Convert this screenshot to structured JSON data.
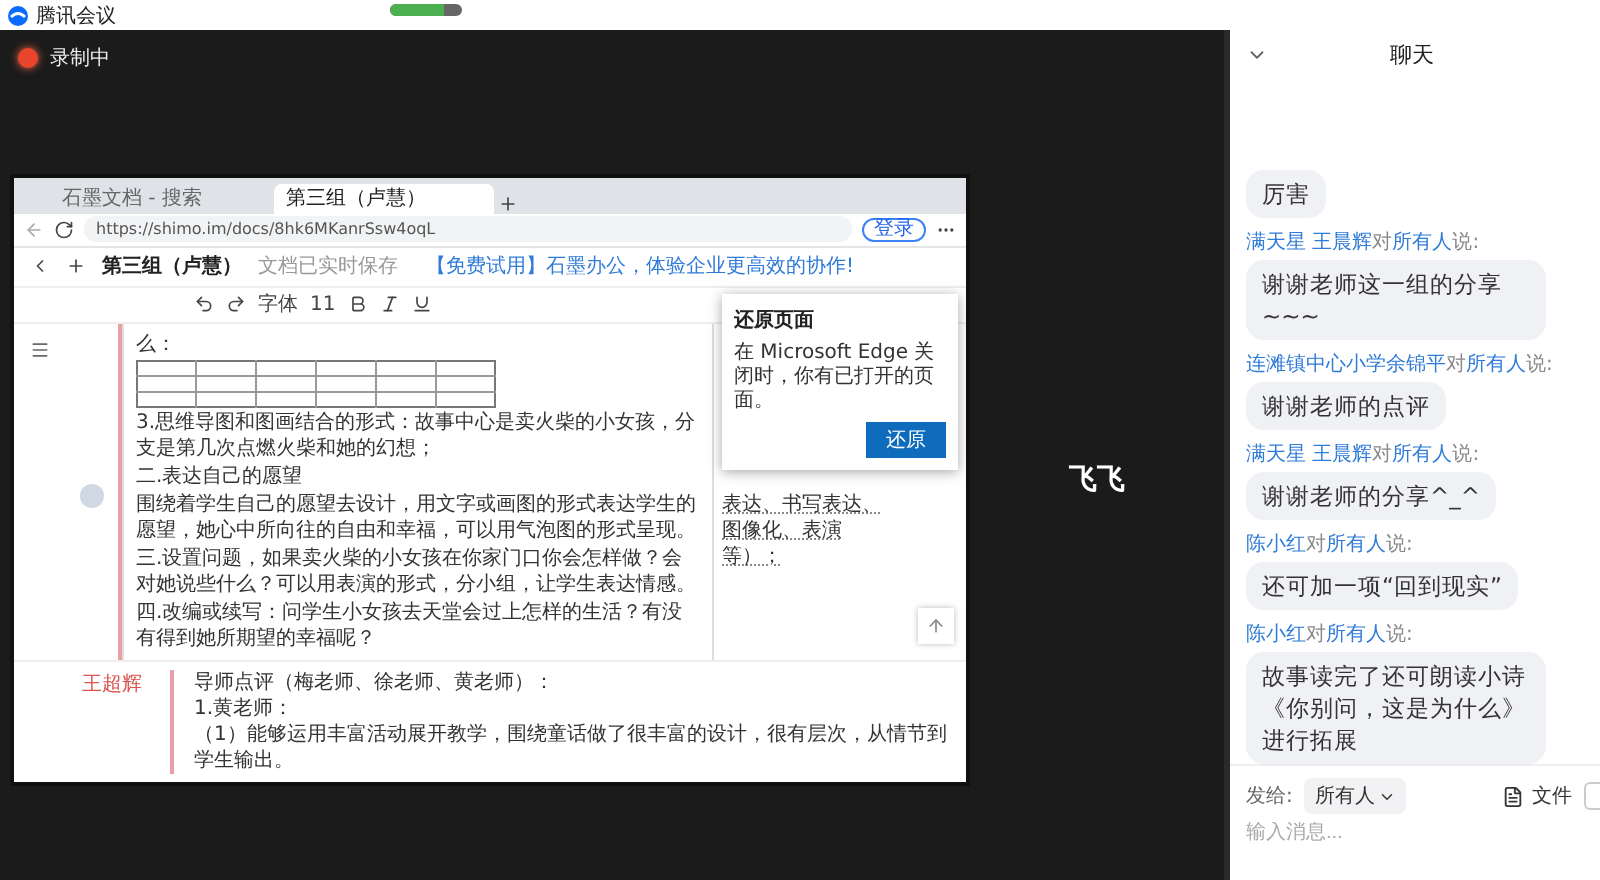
{
  "title_bar": {
    "app_name": "腾讯会议",
    "network_meter": {
      "level": 0.75
    }
  },
  "recording": {
    "label": "录制中"
  },
  "shared_screen": {
    "tabs": [
      {
        "label": "石墨文档 - 搜索",
        "selected": false
      },
      {
        "label": "第三组（卢慧）",
        "selected": true
      }
    ],
    "url": "https://shimo.im/docs/8hk6MKanrSsw4oqL",
    "login": "登录",
    "doc_title": "第三组（卢慧）",
    "save_status": "文档已实时保存",
    "banner": "【免费试用】石墨办公，体验企业更高效的协作!",
    "toolbar": {
      "font": "字体",
      "size": "11"
    },
    "blocks": [
      {
        "kind": "text",
        "text": "么："
      },
      {
        "kind": "table"
      },
      {
        "kind": "text",
        "text": "3.思维导图和图画结合的形式：故事中心是卖火柴的小女孩，分支是第几次点燃火柴和她的幻想；"
      },
      {
        "kind": "text",
        "text": "二.表达自己的愿望"
      },
      {
        "kind": "text",
        "text": "围绕着学生自己的愿望去设计，用文字或画图的形式表达学生的愿望，她心中所向往的自由和幸福，可以用气泡图的形式呈现。"
      },
      {
        "kind": "text",
        "text": "三.设置问题，如果卖火柴的小女孩在你家门口你会怎样做？会对她说些什么？可以用表演的形式，分小组，让学生表达情感。"
      },
      {
        "kind": "text",
        "text": "四.改编或续写：问学生小女孩去天堂会过上怎样的生活？有没有得到她所期望的幸福呢？"
      }
    ],
    "side_note": "表达、书写表达、图像化、表演等）；",
    "reviewer": "王超辉",
    "review": [
      "导师点评（梅老师、徐老师、黄老师）：",
      "1.黄老师：",
      "（1）能够运用丰富活动展开教学，围绕童话做了很丰富的设计，很有层次，从情节到学生输出。"
    ],
    "popup": {
      "title": "还原页面",
      "message": "在 Microsoft Edge 关闭时，你有已打开的页面。",
      "button": "还原"
    }
  },
  "participant": {
    "name": "飞飞"
  },
  "chat": {
    "title": "聊天",
    "messages": [
      {
        "text": "厉害"
      },
      {
        "sender": "满天星 王晨辉",
        "to_word": "对",
        "recipient": "所有人",
        "said": "说:",
        "text": "谢谢老师这一组的分享~~~"
      },
      {
        "sender": "连滩镇中心小学余锦平",
        "to_word": "对",
        "recipient": "所有人",
        "said": "说:",
        "text": "谢谢老师的点评"
      },
      {
        "sender": "满天星 王晨辉",
        "to_word": "对",
        "recipient": "所有人",
        "said": "说:",
        "text": "谢谢老师的分享^_^"
      },
      {
        "sender": "陈小红",
        "to_word": "对",
        "recipient": "所有人",
        "said": "说:",
        "text": "还可加一项“回到现实”"
      },
      {
        "sender": "陈小红",
        "to_word": "对",
        "recipient": "所有人",
        "said": "说:",
        "text": "故事读完了还可朗读小诗《你别问，这是为什么》进行拓展"
      }
    ],
    "composer": {
      "send_to_label": "发给:",
      "recipient": "所有人",
      "file_label": "文件",
      "placeholder": "输入消息..."
    }
  }
}
